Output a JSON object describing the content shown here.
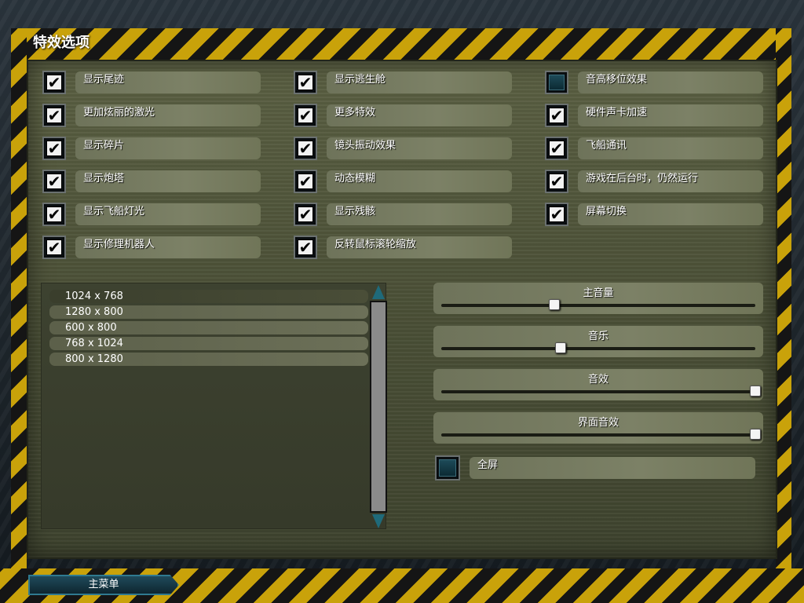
{
  "title": "特效选项",
  "options": {
    "col1": [
      {
        "label": "显示尾迹",
        "checked": true
      },
      {
        "label": "更加炫丽的激光",
        "checked": true
      },
      {
        "label": "显示碎片",
        "checked": true
      },
      {
        "label": "显示炮塔",
        "checked": true
      },
      {
        "label": "显示飞船灯光",
        "checked": true
      },
      {
        "label": "显示修理机器人",
        "checked": true
      }
    ],
    "col2": [
      {
        "label": "显示逃生舱",
        "checked": true
      },
      {
        "label": "更多特效",
        "checked": true
      },
      {
        "label": "镜头振动效果",
        "checked": true
      },
      {
        "label": "动态模糊",
        "checked": true
      },
      {
        "label": "显示残骸",
        "checked": true
      },
      {
        "label": "反转鼠标滚轮缩放",
        "checked": true
      }
    ],
    "col3": [
      {
        "label": "音高移位效果",
        "checked": false
      },
      {
        "label": "硬件声卡加速",
        "checked": true
      },
      {
        "label": "飞船通讯",
        "checked": true
      },
      {
        "label": "游戏在后台时，仍然运行",
        "checked": true
      },
      {
        "label": "屏幕切换",
        "checked": true
      }
    ]
  },
  "resolutions": {
    "items": [
      "1024 x 768",
      "1280 x 800",
      "600 x 800",
      "768 x 1024",
      "800 x 1280"
    ],
    "selected": "1024 x 768"
  },
  "sliders": [
    {
      "label": "主音量",
      "value": 0.36
    },
    {
      "label": "音乐",
      "value": 0.38
    },
    {
      "label": "音效",
      "value": 1.0
    },
    {
      "label": "界面音效",
      "value": 1.0
    }
  ],
  "fullscreen": {
    "label": "全屏",
    "checked": false
  },
  "main_menu_button": "主菜单"
}
